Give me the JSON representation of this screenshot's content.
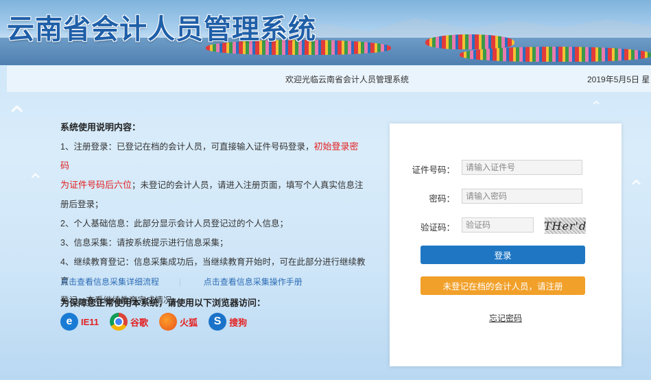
{
  "header": {
    "title": "云南省会计人员管理系统"
  },
  "strip": {
    "welcome": "欢迎光临云南省会计人员管理系统",
    "date": "2019年5月5日 星"
  },
  "instructions": {
    "heading": "系统使用说明内容：",
    "item1_a": "1、注册登录：已登记在档的会计人员，可直接输入证件号码登录，",
    "item1_red_a": "初始登录密码",
    "item1_red_b": "为证件号码后六位",
    "item1_b": "；未登记的会计人员，请进入注册页面，填写个人真实信息注",
    "item1_c": "册后登录；",
    "item2": "2、个人基础信息：此部分显示会计人员登记过的个人信息；",
    "item3": "3、信息采集：请按系统提示进行信息采集；",
    "item4_a": "4、继续教育登记：信息采集成功后，当继续教育开始时，可在此部分进行继续教育",
    "item4_b": "登记、查看继续教育完成情况。"
  },
  "links": {
    "flow": "点击查看信息采集详细流程",
    "manual": "点击查看信息采集操作手册"
  },
  "browsers": {
    "title": "为保障您正常使用本系统，请使用以下浏览器访问：",
    "items": [
      {
        "label": "IE11",
        "icon": "ie-icon",
        "glyph": "e"
      },
      {
        "label": "谷歌",
        "icon": "chrome-icon",
        "glyph": ""
      },
      {
        "label": "火狐",
        "icon": "firefox-icon",
        "glyph": ""
      },
      {
        "label": "搜狗",
        "icon": "sogou-icon",
        "glyph": "S"
      }
    ]
  },
  "login": {
    "id_label": "证件号码：",
    "id_placeholder": "请输入证件号",
    "password_label": "密码：",
    "password_placeholder": "请输入密码",
    "captcha_label": "验证码：",
    "captcha_placeholder": "验证码",
    "captcha_text": "THer'd",
    "login_button": "登录",
    "register_button": "未登记在档的会计人员，请注册",
    "forgot": "忘记密码"
  },
  "colors": {
    "primary": "#1f77c4",
    "register": "#f1a02a",
    "link": "#2d6db6",
    "highlight": "#e41f1f"
  }
}
